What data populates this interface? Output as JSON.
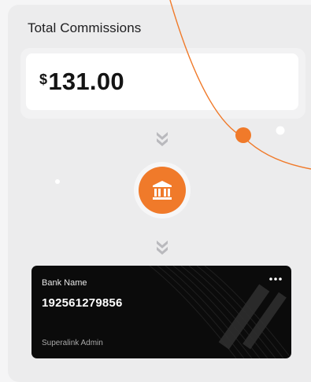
{
  "header": {
    "title": "Total Commissions"
  },
  "amount": {
    "currency": "$",
    "value": "131.00"
  },
  "icons": {
    "flow_down_top": "double-chevron-down-icon",
    "bank": "bank-icon",
    "flow_down_bottom": "double-chevron-down-icon",
    "card_menu": "more-horizontal-icon"
  },
  "card": {
    "bank_name": "Bank Name",
    "account_number": "192561279856",
    "owner": "Superalink Admin"
  },
  "colors": {
    "accent": "#f07a2a",
    "panel": "#ececed",
    "card": "#0b0b0b"
  }
}
